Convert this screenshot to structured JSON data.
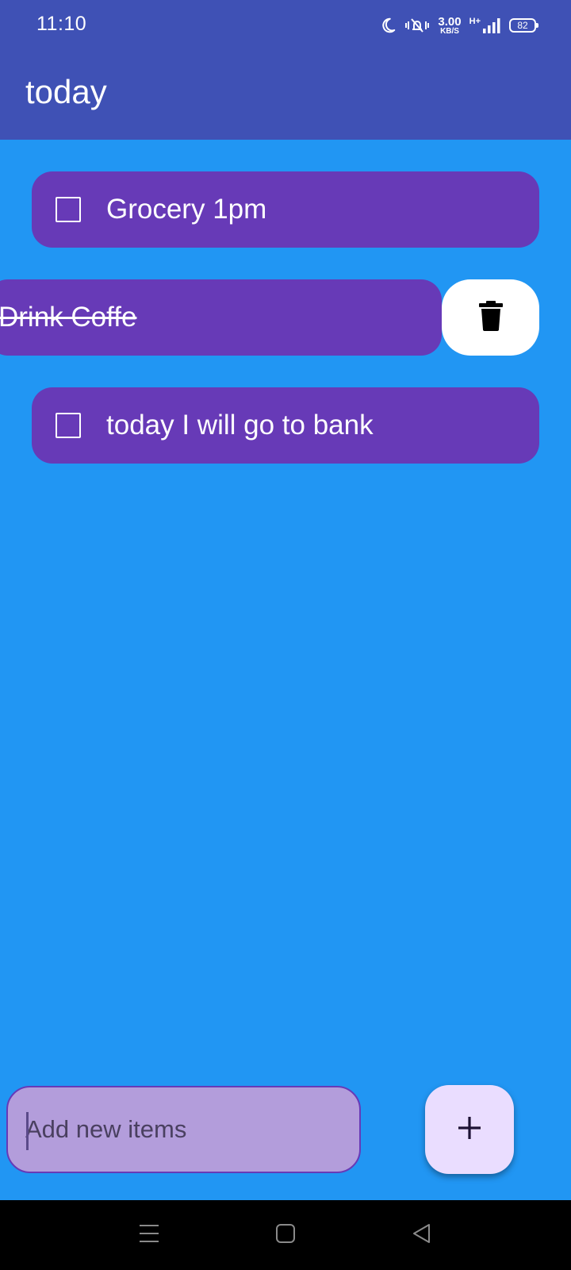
{
  "status_bar": {
    "time": "11:10",
    "speed_value": "3.00",
    "speed_unit": "KB/S",
    "network_type": "H+",
    "battery": "82",
    "icons": [
      "moon-icon",
      "vibrate-silent-icon",
      "signal-icon",
      "battery-icon"
    ]
  },
  "app_bar": {
    "title": "today"
  },
  "tasks": [
    {
      "label": "Grocery 1pm",
      "done": false
    },
    {
      "label": "Drink Coffe",
      "done": true,
      "swiped": true
    },
    {
      "label": "today I will go to bank",
      "done": false
    }
  ],
  "delete_action": {
    "icon": "trash-icon"
  },
  "new_item": {
    "placeholder": "Add new items",
    "value": ""
  },
  "fab": {
    "icon": "plus-icon"
  },
  "nav_bar": {
    "buttons": [
      "menu-icon",
      "home-icon",
      "back-icon"
    ]
  },
  "colors": {
    "app_bar": "#3f51b5",
    "background": "#2196f3",
    "task": "#673ab7",
    "input": "#b39ddb",
    "fab": "#eaddff"
  }
}
